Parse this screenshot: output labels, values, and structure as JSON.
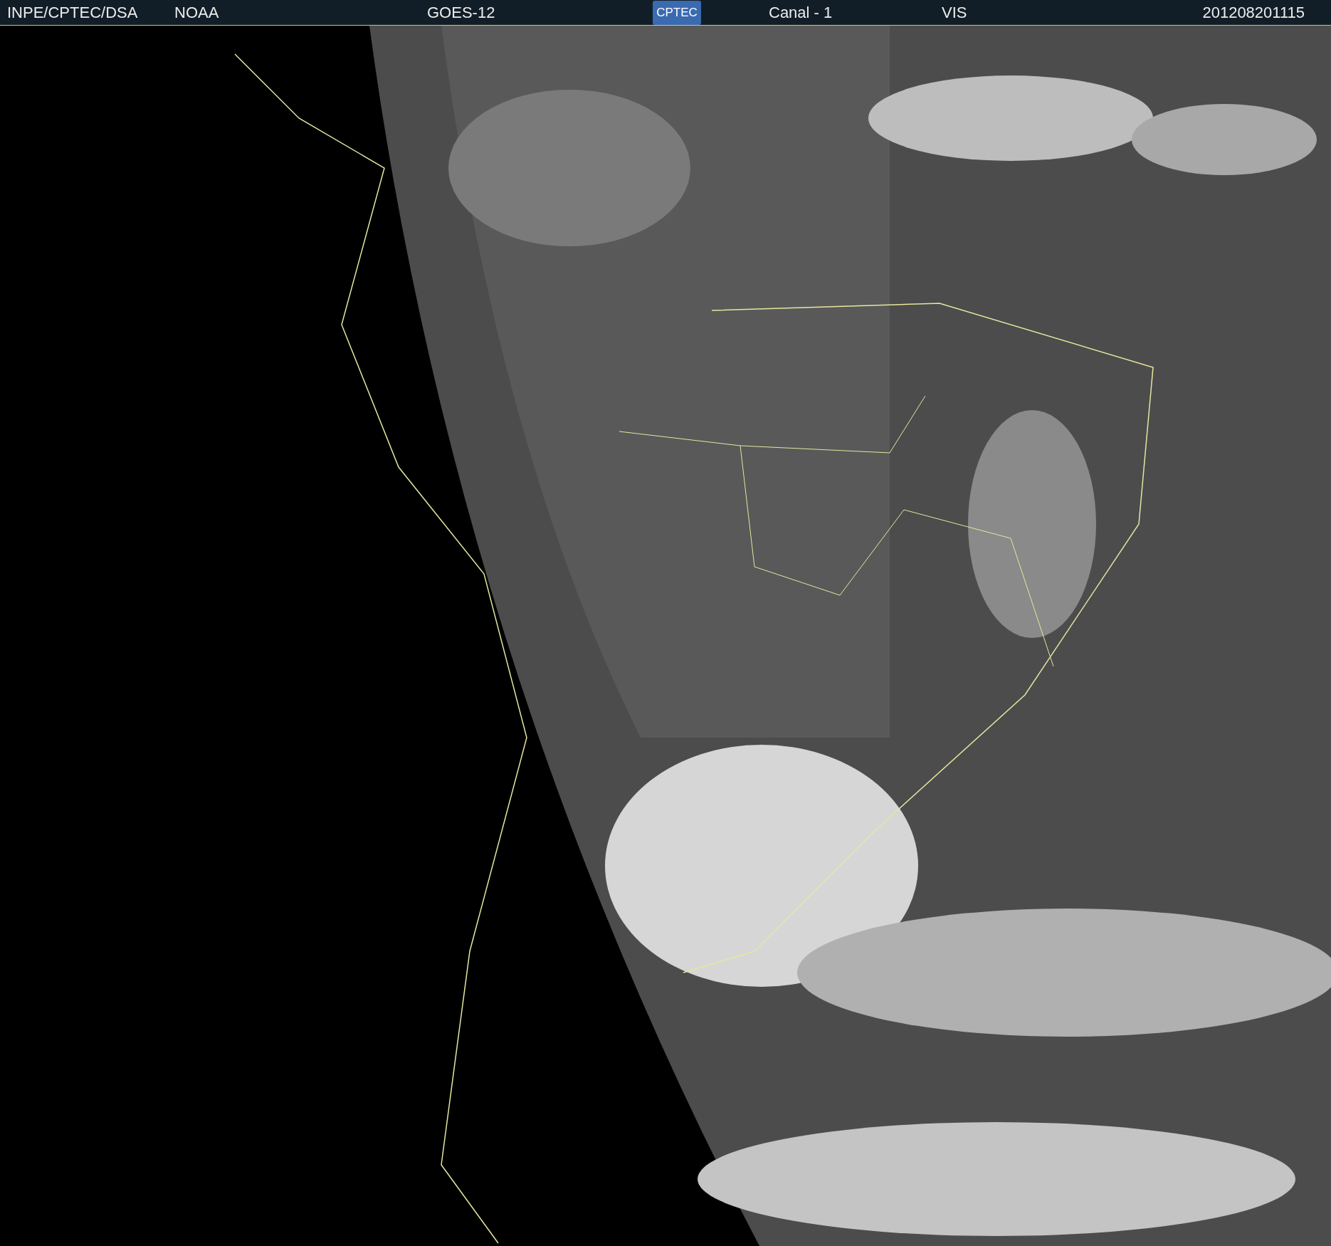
{
  "header": {
    "agency": "INPE/CPTEC/DSA",
    "source": "NOAA",
    "satellite": "GOES-12",
    "logo": "CPTEC",
    "channel": "Canal - 1",
    "band": "VIS",
    "timestamp": "201208201115"
  }
}
